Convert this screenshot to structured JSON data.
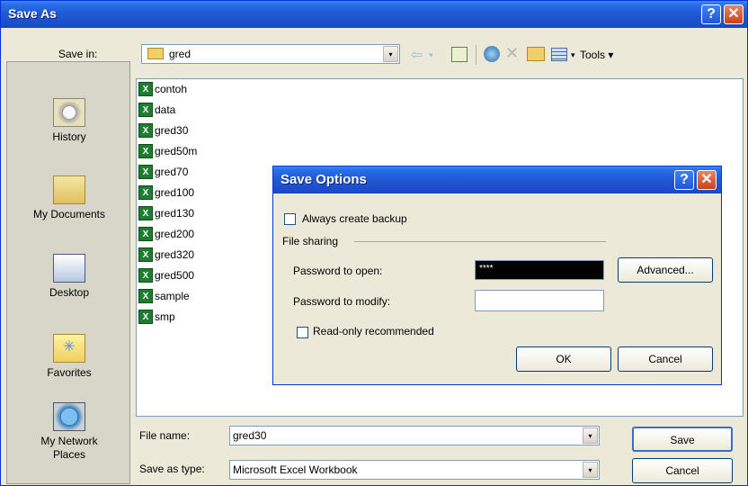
{
  "dialog": {
    "title": "Save As",
    "help_glyph": "?",
    "close_glyph": "✕"
  },
  "toolbar": {
    "save_in_label": "Save in:",
    "folder": "gred",
    "back_glyph": "⇦",
    "tools_label": "Tools",
    "dropdown_glyph": "▾"
  },
  "places": [
    {
      "label": "History",
      "icon": "history-icon"
    },
    {
      "label": "My Documents",
      "icon": "my-documents-icon"
    },
    {
      "label": "Desktop",
      "icon": "desktop-icon"
    },
    {
      "label": "Favorites",
      "icon": "favorites-icon"
    },
    {
      "label": "My Network Places",
      "icon": "network-places-icon"
    }
  ],
  "files": [
    "contoh",
    "data",
    "gred30",
    "gred50m",
    "gred70",
    "gred100",
    "gred130",
    "gred200",
    "gred320",
    "gred500",
    "sample",
    "smp"
  ],
  "file_icon_glyph": "X",
  "bottom": {
    "file_name_label": "File name:",
    "file_name_value": "gred30",
    "save_type_label": "Save as type:",
    "save_type_value": "Microsoft Excel Workbook",
    "save_button": "Save",
    "cancel_button": "Cancel"
  },
  "save_options": {
    "title": "Save Options",
    "always_backup": "Always create backup",
    "file_sharing": "File sharing",
    "password_open_label": "Password to open:",
    "password_open_value": "****",
    "password_modify_label": "Password to modify:",
    "password_modify_value": "",
    "advanced_button": "Advanced...",
    "read_only": "Read-only recommended",
    "ok_button": "OK",
    "cancel_button": "Cancel"
  }
}
